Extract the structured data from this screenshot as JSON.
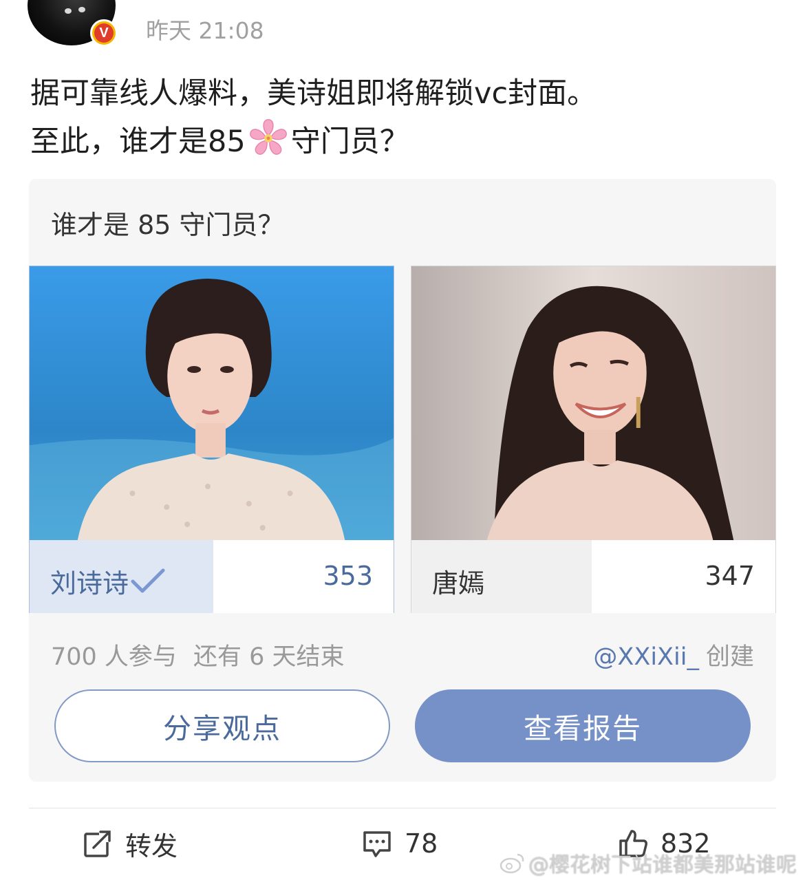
{
  "post": {
    "timestamp": "昨天 21:08",
    "line1": "据可靠线人爆料，美诗姐即将解锁vc封面。",
    "line2_prefix": "至此，谁才是85",
    "line2_suffix": "守门员？",
    "emoji": "cherry-blossom-icon",
    "verified_badge": "V"
  },
  "poll": {
    "title": "谁才是 85 守门员？",
    "options": [
      {
        "name": "刘诗诗",
        "votes": "353",
        "selected": true
      },
      {
        "name": "唐嫣",
        "votes": "347",
        "selected": false
      }
    ],
    "participants": "700 人参与",
    "remaining": "还有 6 天结束",
    "creator_handle": "@XXiXii_",
    "creator_suffix": "创建",
    "share_label": "分享观点",
    "report_label": "查看报告"
  },
  "actions": {
    "repost_label": "转发",
    "comment_count": "78",
    "like_count": "832"
  },
  "watermark": "@樱花树下站谁都美那站谁呢",
  "colors": {
    "accent": "#7591c7",
    "link": "#5a78b0",
    "selected_bar": "#dfe6f4",
    "badge_red": "#e03c2c",
    "badge_gold": "#f5b800"
  }
}
